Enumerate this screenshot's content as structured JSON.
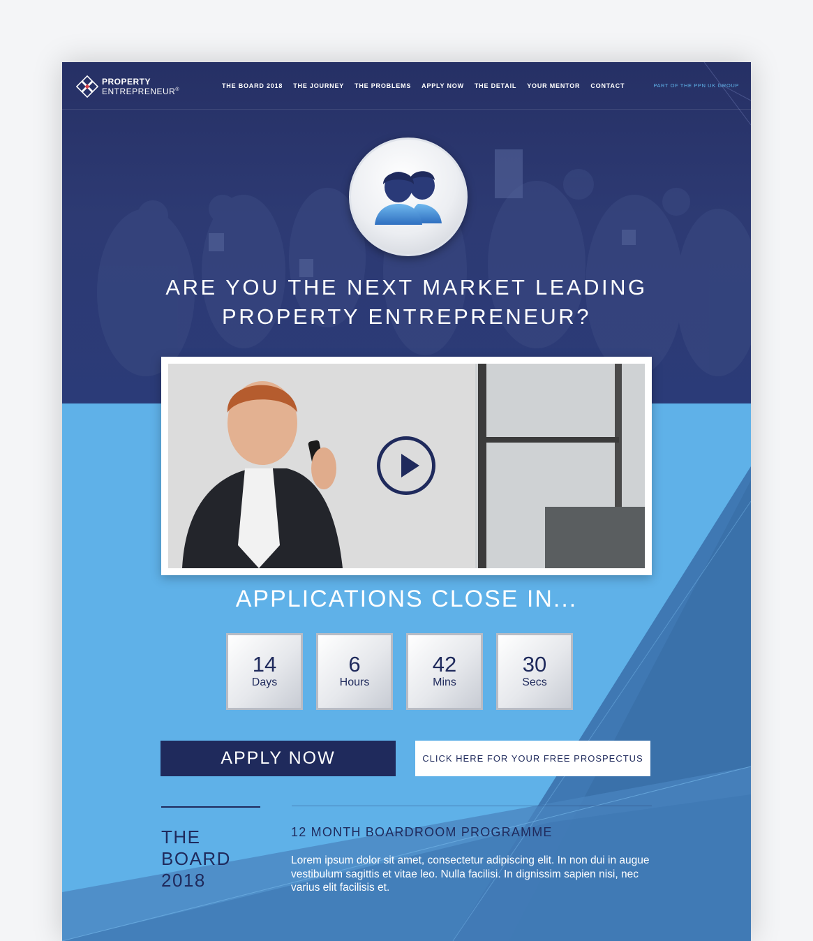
{
  "brand": {
    "line1": "PROPERTY",
    "line2": "ENTREPRENEUR",
    "mark": "®"
  },
  "nav": {
    "items": [
      "THE BOARD 2018",
      "THE JOURNEY",
      "THE PROBLEMS",
      "APPLY NOW",
      "THE DETAIL",
      "YOUR MENTOR",
      "CONTACT"
    ],
    "group_tag": "PART OF THE PPN UK GROUP"
  },
  "hero": {
    "title_line1": "ARE YOU THE NEXT MARKET LEADING",
    "title_line2": "PROPERTY ENTREPRENEUR?",
    "icon": "people-icon"
  },
  "video": {
    "icon": "play-icon"
  },
  "countdown": {
    "title": "APPLICATIONS CLOSE IN...",
    "units": [
      {
        "value": "14",
        "label": "Days"
      },
      {
        "value": "6",
        "label": "Hours"
      },
      {
        "value": "42",
        "label": "Mins"
      },
      {
        "value": "30",
        "label": "Secs"
      }
    ]
  },
  "cta": {
    "apply_label": "APPLY NOW",
    "prospectus_label": "CLICK HERE FOR YOUR FREE PROSPECTUS"
  },
  "board": {
    "title_lines": [
      "THE",
      "BOARD",
      "2018"
    ],
    "subtitle": "12 MONTH BOARDROOM PROGRAMME",
    "body": "Lorem ipsum dolor sit amet, consectetur adipiscing elit. In non dui in augue vestibulum sagittis et vitae leo. Nulla facilisi. In dignissim sapien nisi, nec varius elit facilisis et."
  },
  "colors": {
    "navy": "#1f2a5c",
    "hero": "#2b3b78",
    "sky": "#5fb1e8",
    "mid_blue": "#3f78b3",
    "white": "#ffffff"
  }
}
